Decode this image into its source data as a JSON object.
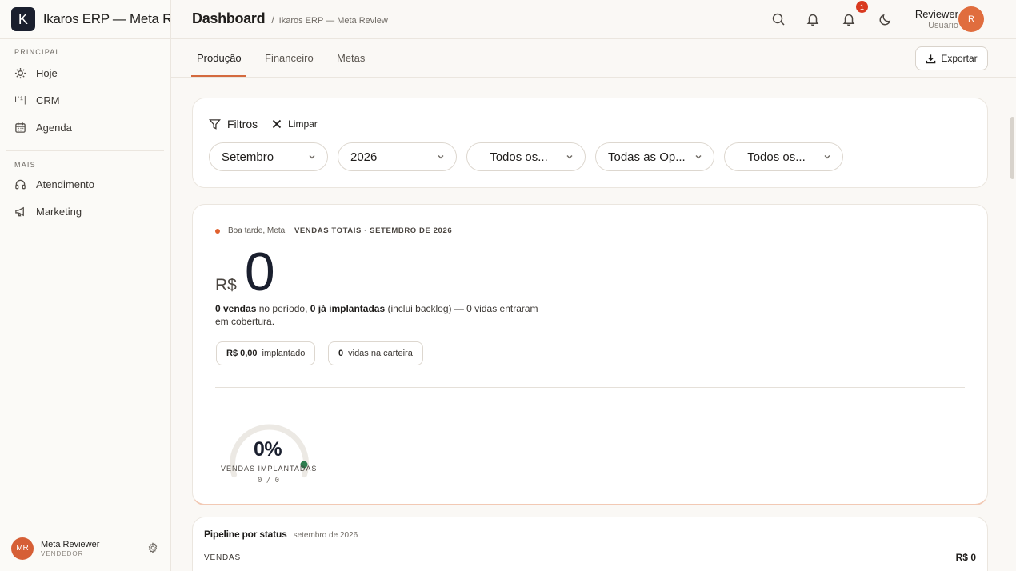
{
  "app": {
    "logo_letter": "K",
    "name": "Ikaros ERP — Meta Review"
  },
  "sidebar": {
    "section_principal": "PRINCIPAL",
    "section_mais": "MAIS",
    "items_principal": [
      {
        "label": "Hoje",
        "icon": "sun-icon"
      },
      {
        "label": "CRM",
        "icon": "kanban-icon",
        "icon_text": "I'¹|"
      },
      {
        "label": "Agenda",
        "icon": "calendar-icon"
      }
    ],
    "items_mais": [
      {
        "label": "Atendimento",
        "icon": "headset-icon"
      },
      {
        "label": "Marketing",
        "icon": "megaphone-icon"
      }
    ],
    "user": {
      "initials": "MR",
      "name": "Meta Reviewer",
      "role": "VENDEDOR"
    }
  },
  "header": {
    "title": "Dashboard",
    "separator": "/",
    "breadcrumb": "Ikaros ERP — Meta Review",
    "notification_count": "1",
    "user_name": "Reviewer",
    "user_role": "Usuário",
    "user_initial": "R"
  },
  "tabs": [
    {
      "label": "Produção",
      "active": true
    },
    {
      "label": "Financeiro",
      "active": false
    },
    {
      "label": "Metas",
      "active": false
    }
  ],
  "export_label": "Exportar",
  "filters": {
    "title": "Filtros",
    "clear_label": "Limpar",
    "selects": [
      "Setembro",
      "2026",
      "Todos os...",
      "Todas as Op...",
      "Todos os..."
    ]
  },
  "sales": {
    "greeting": "Boa tarde, Meta.",
    "heading": "VENDAS TOTAIS · SETEMBRO DE 2026",
    "currency": "R$",
    "amount": "0",
    "summary": {
      "sales_count": "0 vendas",
      "t1": " no período, ",
      "implanted": "0 já implantadas",
      "t2": " (inclui backlog) — 0 vidas entraram em cobertura."
    },
    "chips": [
      {
        "value": "R$ 0,00",
        "label": "implantado"
      },
      {
        "value": "0",
        "label": "vidas na carteira"
      }
    ],
    "gauge": {
      "percent_text": "0%",
      "percent": 0,
      "label": "VENDAS IMPLANTADAS",
      "count": "0 / 0"
    }
  },
  "pipeline": {
    "title": "Pipeline por status",
    "subtitle": "setembro de 2026",
    "row_label": "VENDAS",
    "row_value": "R$ 0"
  },
  "colors": {
    "accent": "#d46a3e",
    "brand_dark": "#1a1f2e",
    "badge": "#d9391f",
    "gauge_dot": "#2e7d4f"
  }
}
